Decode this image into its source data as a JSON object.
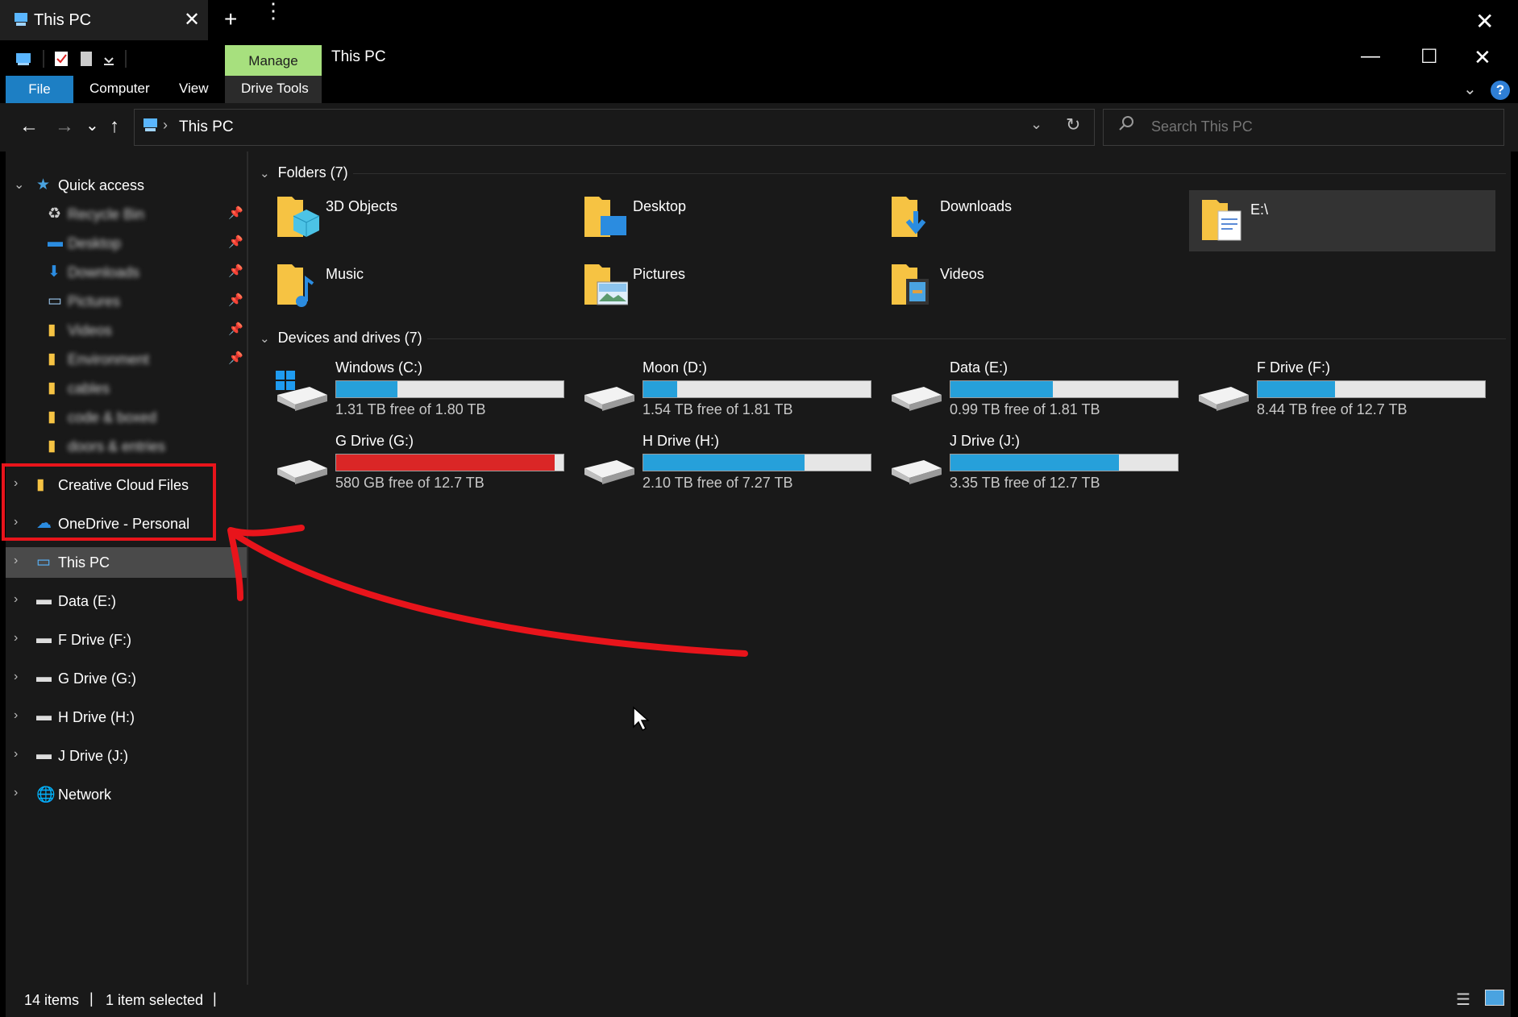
{
  "tab": {
    "title": "This PC",
    "close": "✕",
    "new": "+",
    "menu": "⋮",
    "strip_close": "✕"
  },
  "titlebar": {
    "manage_label": "Manage",
    "window_title": "This PC",
    "ribbon_tabs": [
      "File",
      "Computer",
      "View",
      "Drive Tools"
    ],
    "minimize": "—",
    "maximize": "☐",
    "close": "✕",
    "help": "?"
  },
  "address": {
    "back": "←",
    "forward": "→",
    "recent": "⌄",
    "up": "↑",
    "sep": "›",
    "path": "This PC",
    "refresh": "↻",
    "search_placeholder": "Search This PC"
  },
  "nav": {
    "quick_access": "Quick access",
    "qa_items": [
      {
        "label": "Recycle Bin",
        "icon": "recycle-bin-icon",
        "pinned": true
      },
      {
        "label": "Desktop",
        "icon": "desktop-icon",
        "pinned": true
      },
      {
        "label": "Downloads",
        "icon": "download-icon",
        "pinned": true
      },
      {
        "label": "Pictures",
        "icon": "pictures-icon",
        "pinned": true
      },
      {
        "label": "Videos",
        "icon": "folder-icon",
        "pinned": true
      },
      {
        "label": "Environment",
        "icon": "folder-icon",
        "pinned": true
      },
      {
        "label": "cables",
        "icon": "folder-icon",
        "pinned": false
      },
      {
        "label": "code & boxed",
        "icon": "folder-icon",
        "pinned": false
      },
      {
        "label": "doors & entries",
        "icon": "folder-icon",
        "pinned": false
      }
    ],
    "creative_cloud": "Creative Cloud Files",
    "onedrive": "OneDrive - Personal",
    "this_pc": "This PC",
    "data_e": "Data (E:)",
    "f_drive": "F Drive (F:)",
    "g_drive": "G Drive (G:)",
    "h_drive": "H Drive (H:)",
    "j_drive": "J Drive (J:)",
    "network": "Network"
  },
  "content": {
    "folders_header": "Folders (7)",
    "folders": [
      "3D Objects",
      "Desktop",
      "Downloads",
      "E:\\",
      "Music",
      "Pictures",
      "Videos"
    ],
    "drives_header": "Devices and drives (7)",
    "drives": [
      {
        "name": "Windows (C:)",
        "free": "1.31 TB free of 1.80 TB",
        "used_fraction": 0.27
      },
      {
        "name": "Moon (D:)",
        "free": "1.54 TB free of 1.81 TB",
        "used_fraction": 0.15
      },
      {
        "name": "Data (E:)",
        "free": "0.99 TB free of 1.81 TB",
        "used_fraction": 0.45
      },
      {
        "name": "F Drive (F:)",
        "free": "8.44 TB free of 12.7 TB",
        "used_fraction": 0.34
      },
      {
        "name": "G Drive (G:)",
        "free": "580 GB free of 12.7 TB",
        "used_fraction": 0.96
      },
      {
        "name": "H Drive (H:)",
        "free": "2.10 TB free of 7.27 TB",
        "used_fraction": 0.71
      },
      {
        "name": "J Drive (J:)",
        "free": "3.35 TB free of 12.7 TB",
        "used_fraction": 0.74
      }
    ]
  },
  "status": {
    "items": "14 items",
    "selected": "1 item selected",
    "sep": "|"
  },
  "colors": {
    "accent": "#1d7fc4",
    "manage": "#a7e07e",
    "bar_fill": "#26a0da",
    "bar_full": "#da2626",
    "annotation": "#e8141b"
  }
}
